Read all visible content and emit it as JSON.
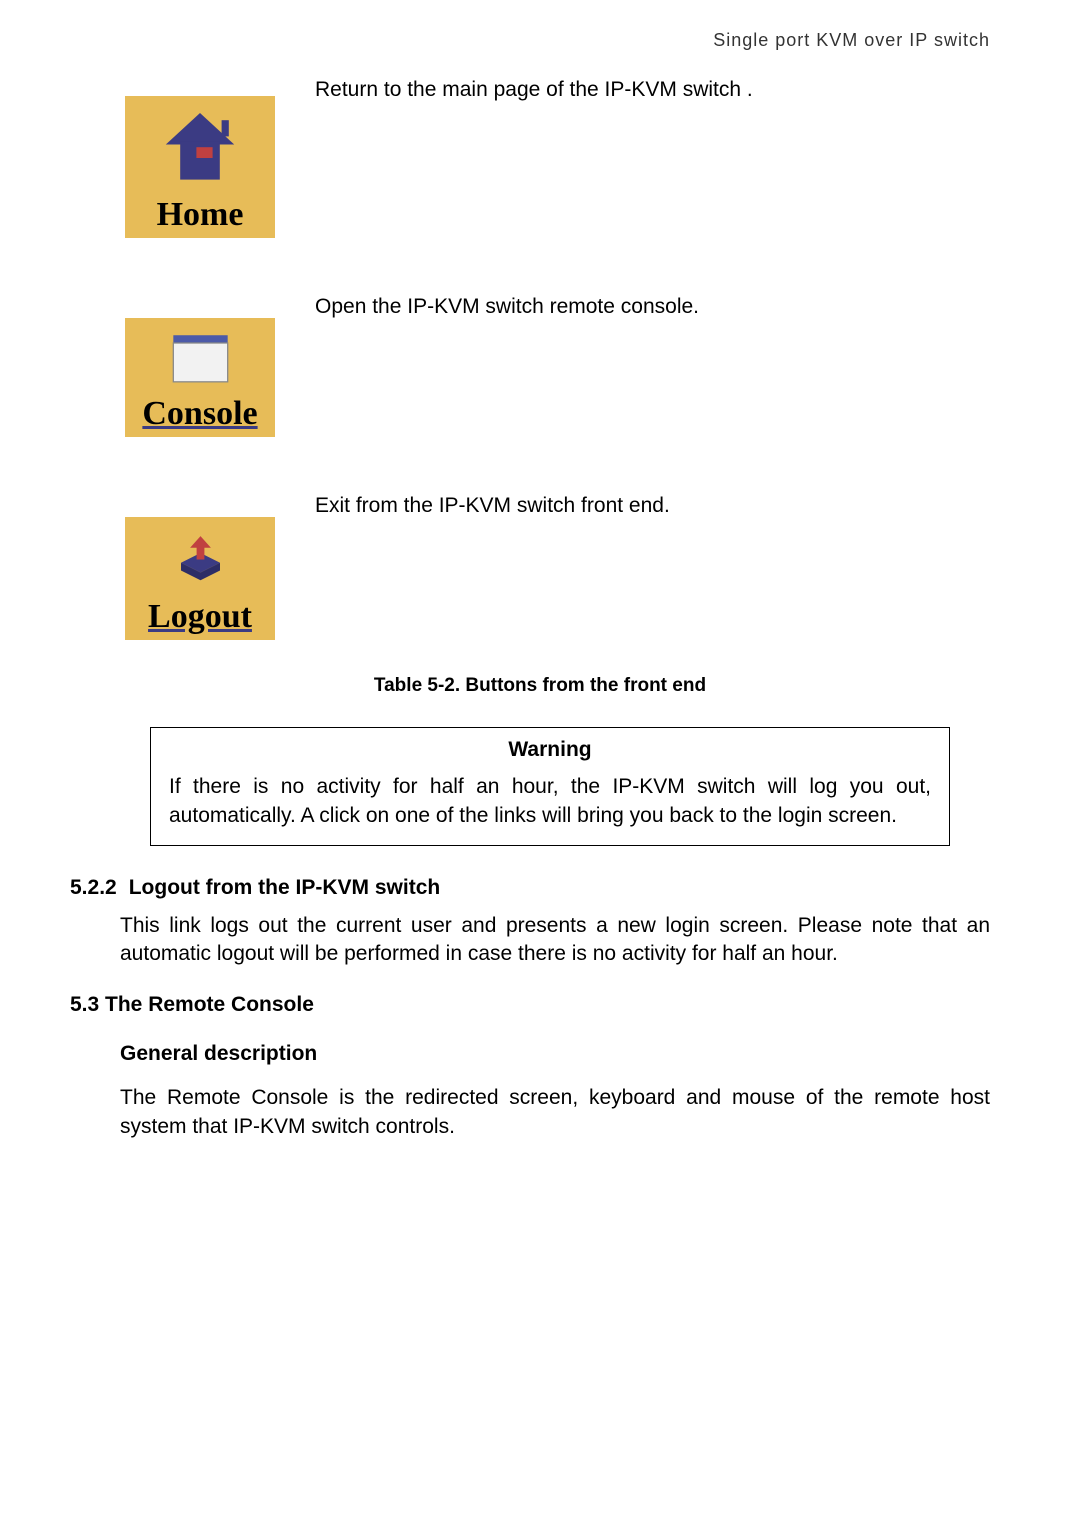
{
  "header": {
    "title": "Single port KVM over IP switch"
  },
  "items": [
    {
      "label": "Home",
      "icon_name": "home-icon",
      "desc": " Return to the main page of the IP-KVM switch ."
    },
    {
      "label": "Console",
      "icon_name": "console-icon",
      "desc": "Open the IP-KVM switch remote console."
    },
    {
      "label": "Logout",
      "icon_name": "logout-icon",
      "desc": "Exit from the IP-KVM switch front end."
    }
  ],
  "table_caption": "Table 5-2. Buttons from the front end",
  "warning": {
    "title": "Warning",
    "body": "If there is no activity for half an hour, the IP-KVM switch will log you out, automatically. A click on one of the links will bring you back to the login screen."
  },
  "sections": {
    "s522_num": "5.2.2",
    "s522_title": "Logout from the IP-KVM switch",
    "s522_body": "This link logs out the current user and presents a new login screen. Please note that an automatic logout will be performed in case there is no activity for half an hour.",
    "s53_title": "5.3 The Remote Console",
    "s53_sub": "General description",
    "s53_body": "The Remote Console is the redirected screen, keyboard and mouse of the remote host system that IP-KVM switch controls."
  }
}
